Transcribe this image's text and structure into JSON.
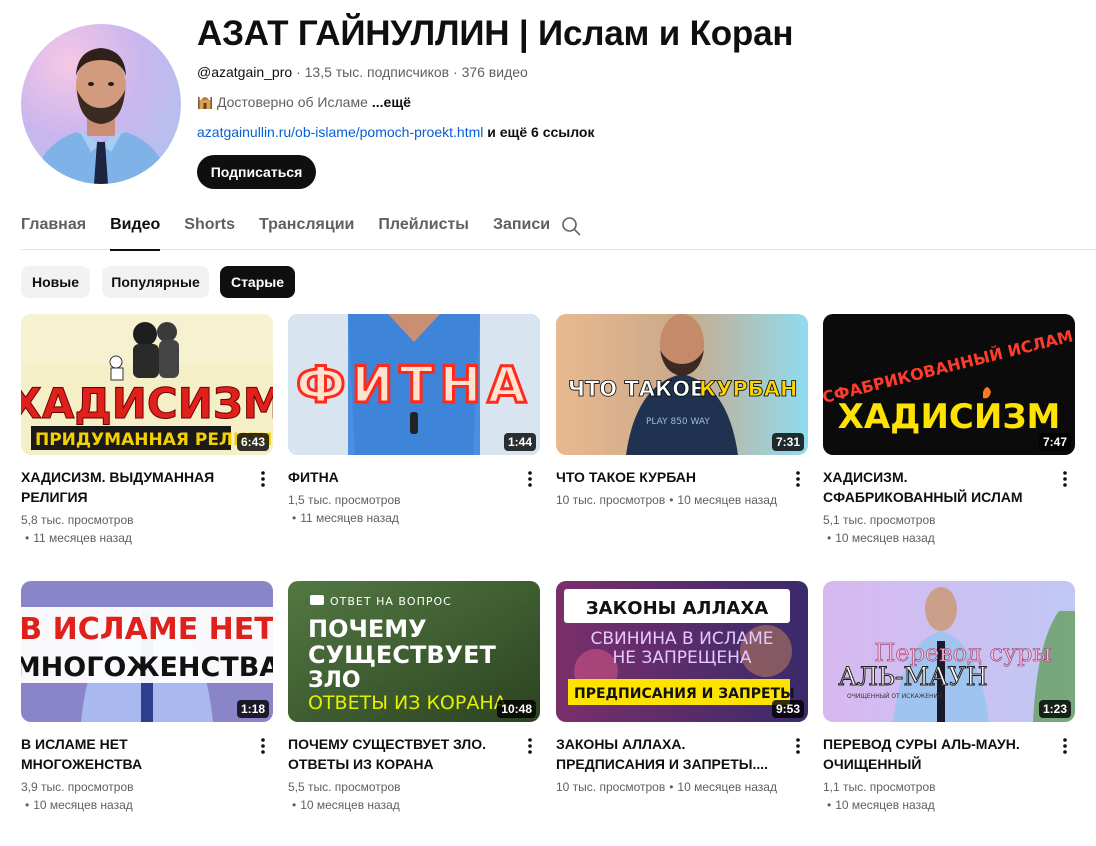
{
  "channel": {
    "title": "АЗАТ ГАЙНУЛЛИН | Ислам и Коран",
    "handle": "@azatgain_pro",
    "subscribers": "13,5 тыс. подписчиков",
    "videos_count": "376 видео",
    "description": "Достоверно об Исламе",
    "description_more": "...ещё",
    "link": "azatgainullin.ru/ob-islame/pomoch-proekt.html",
    "links_more": "и ещё 6 ссылок",
    "subscribe_label": "Подписаться"
  },
  "tabs": [
    {
      "label": "Главная",
      "active": false
    },
    {
      "label": "Видео",
      "active": true
    },
    {
      "label": "Shorts",
      "active": false
    },
    {
      "label": "Трансляции",
      "active": false
    },
    {
      "label": "Плейлисты",
      "active": false
    },
    {
      "label": "Записи",
      "active": false
    }
  ],
  "chips": [
    {
      "label": "Новые",
      "active": false
    },
    {
      "label": "Популярные",
      "active": false
    },
    {
      "label": "Старые",
      "active": true
    }
  ],
  "videos": [
    {
      "title": "ХАДИСИЗМ. ВЫДУМАННАЯ РЕЛИГИЯ",
      "views": "5,8 тыс. просмотров",
      "age": "11 месяцев назад",
      "duration": "6:43",
      "thumb_text": [
        "ХАДИСИЗМ",
        "ПРИДУМАННАЯ РЕЛИГИЯ"
      ]
    },
    {
      "title": "ФИТНА",
      "views": "1,5 тыс. просмотров",
      "age": "11 месяцев назад",
      "duration": "1:44",
      "thumb_text": [
        "ФИТНА"
      ]
    },
    {
      "title": "ЧТО ТАКОЕ КУРБАН",
      "views": "10 тыс. просмотров",
      "age": "10 месяцев назад",
      "duration": "7:31",
      "thumb_text": [
        "ЧТО ТАКОЕ",
        "КУРБАН"
      ]
    },
    {
      "title": "ХАДИСИЗМ. СФАБРИКОВАННЫЙ ИСЛАМ",
      "views": "5,1 тыс. просмотров",
      "age": "10 месяцев назад",
      "duration": "7:47",
      "thumb_text": [
        "СФАБРИКОВАННЫЙ ИСЛАМ",
        "ХАДИСИЗМ"
      ]
    },
    {
      "title": "В ИСЛАМЕ НЕТ МНОГОЖЕНСТВА",
      "views": "3,9 тыс. просмотров",
      "age": "10 месяцев назад",
      "duration": "1:18",
      "thumb_text": [
        "В ИСЛАМЕ НЕТ",
        "МНОГОЖЕНСТВА"
      ]
    },
    {
      "title": "ПОЧЕМУ СУЩЕСТВУЕТ ЗЛО. ОТВЕТЫ ИЗ КОРАНА",
      "views": "5,5 тыс. просмотров",
      "age": "10 месяцев назад",
      "duration": "10:48",
      "thumb_text": [
        "ОТВЕТ НА ВОПРОС",
        "ПОЧЕМУ",
        "СУЩЕСТВУЕТ",
        "ЗЛО",
        "ОТВЕТЫ ИЗ КОРАНА"
      ]
    },
    {
      "title": "ЗАКОНЫ АЛЛАХА. ПРЕДПИСАНИЯ И ЗАПРЕТЫ....",
      "views": "10 тыс. просмотров",
      "age": "10 месяцев назад",
      "duration": "9:53",
      "thumb_text": [
        "ЗАКОНЫ АЛЛАХА",
        "СВИНИНА В ИСЛАМЕ",
        "НЕ ЗАПРЕЩЕНА",
        "ПРЕДПИСАНИЯ И ЗАПРЕТЫ"
      ]
    },
    {
      "title": "ПЕРЕВОД СУРЫ АЛЬ-МАУН. ОЧИЩЕННЫЙ",
      "views": "1,1 тыс. просмотров",
      "age": "10 месяцев назад",
      "duration": "1:23",
      "thumb_text": [
        "Перевод суры",
        "АЛЬ-МАУН",
        "ОЧИЩЕННЫЙ ОТ ИСКАЖЕНИЙ"
      ]
    }
  ]
}
